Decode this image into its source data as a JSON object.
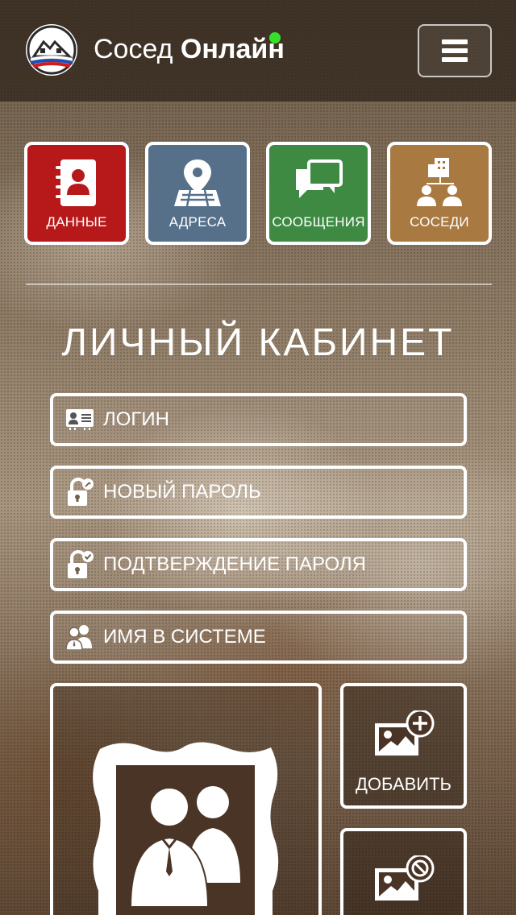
{
  "header": {
    "title_regular": "Сосед",
    "title_bold": "Онлайн",
    "online_color": "#36e02a",
    "logo_icon": "houses-flag-logo",
    "menu_icon": "hamburger-icon"
  },
  "tiles": [
    {
      "label": "ДАННЫЕ",
      "icon": "contact-book-icon",
      "color": "#b7191a"
    },
    {
      "label": "АДРЕСА",
      "icon": "map-pin-icon",
      "color": "#56708a"
    },
    {
      "label": "СООБЩЕНИЯ",
      "icon": "chat-bubbles-icon",
      "color": "#3e8a42"
    },
    {
      "label": "СОСЕДИ",
      "icon": "neighbors-icon",
      "color": "#a87a41"
    }
  ],
  "section": {
    "title": "ЛИЧНЫЙ КАБИНЕТ"
  },
  "form": {
    "login_placeholder": "ЛОГИН",
    "new_password_placeholder": "НОВЫЙ ПАРОЛЬ",
    "confirm_password_placeholder": "ПОДТВЕРЖДЕНИЕ ПАРОЛЯ",
    "display_name_placeholder": "ИМЯ В СИСТЕМЕ"
  },
  "photo": {
    "add_label": "ДОБАВИТЬ",
    "frame_icon": "couple-portrait-icon",
    "add_icon": "image-add-icon",
    "remove_icon": "image-remove-icon"
  }
}
